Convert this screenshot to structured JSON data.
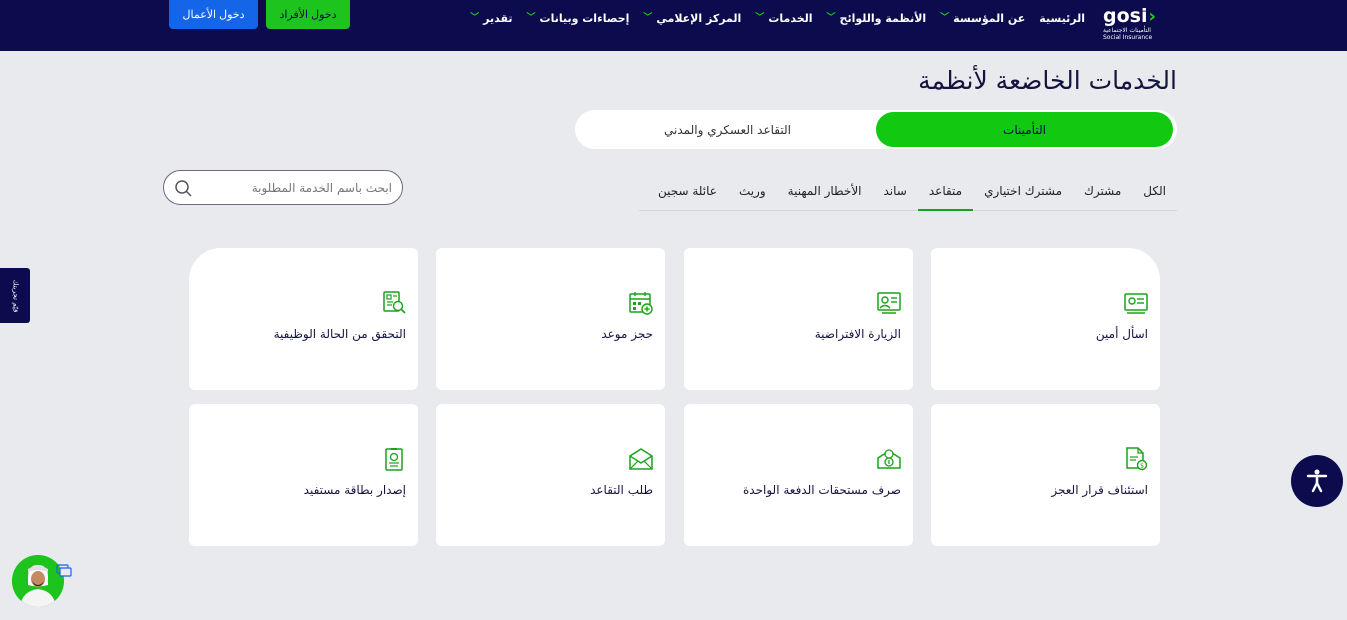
{
  "header": {
    "logo_word": "gosi",
    "logo_sub_ar": "التأمينات الاجتماعية",
    "logo_sub_en": "Social Insurance",
    "nav": [
      {
        "label": "الرئيسية",
        "has_dropdown": false
      },
      {
        "label": "عن المؤسسة",
        "has_dropdown": true
      },
      {
        "label": "الأنظمة واللوائح",
        "has_dropdown": true
      },
      {
        "label": "الخدمات",
        "has_dropdown": true
      },
      {
        "label": "المركز الإعلامي",
        "has_dropdown": true
      },
      {
        "label": "إحصاءات وبيانات",
        "has_dropdown": true
      },
      {
        "label": "تقدير",
        "has_dropdown": true
      }
    ],
    "individuals_login": "دخول الأفراد",
    "business_login": "دخول الأعمال"
  },
  "page": {
    "title": "الخدمات الخاضعة لأنظمة"
  },
  "segment": {
    "active": "التأمينات",
    "inactive": "التقاعد العسكري والمدني"
  },
  "tabs": [
    {
      "label": "الكل",
      "active": false
    },
    {
      "label": "مشترك",
      "active": false
    },
    {
      "label": "مشترك اختياري",
      "active": false
    },
    {
      "label": "متقاعد",
      "active": true
    },
    {
      "label": "ساند",
      "active": false
    },
    {
      "label": "الأخطار المهنية",
      "active": false
    },
    {
      "label": "وريث",
      "active": false
    },
    {
      "label": "عائلة سجين",
      "active": false
    }
  ],
  "search": {
    "placeholder": "ابحث باسم الخدمة المطلوبة",
    "value": ""
  },
  "cards": [
    {
      "label": "اسأل أمين",
      "icon": "chat-screen-icon"
    },
    {
      "label": "الزيارة الافتراضية",
      "icon": "virtual-visit-icon"
    },
    {
      "label": "حجز موعد",
      "icon": "calendar-icon"
    },
    {
      "label": "التحقق من الحالة الوظيفية",
      "icon": "document-search-icon"
    },
    {
      "label": "استئناف قرار العجز",
      "icon": "document-appeal-icon"
    },
    {
      "label": "صرف مستحقات الدفعة الواحدة",
      "icon": "payment-icon"
    },
    {
      "label": "طلب التقاعد",
      "icon": "envelope-icon"
    },
    {
      "label": "إصدار بطاقة مستفيد",
      "icon": "id-card-icon"
    }
  ],
  "side_tab": "قيّم تجربتك",
  "colors": {
    "navy": "#0b0b4d",
    "green": "#12c912",
    "blue": "#1565e8",
    "icon_green": "#1aa21a"
  }
}
